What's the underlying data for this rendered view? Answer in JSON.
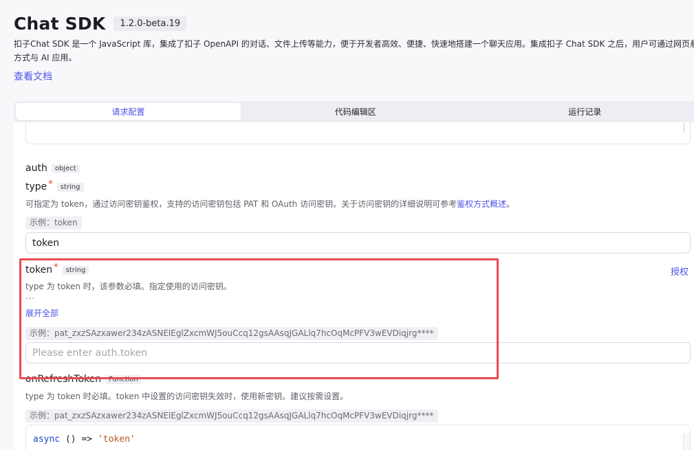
{
  "header": {
    "title": "Chat SDK",
    "version": "1.2.0-beta.19",
    "description_line1": "扣子Chat SDK 是一个 JavaScript 库，集成了扣子 OpenAPI 的对话、文件上传等能力，便于开发者高效、便捷、快速地搭建一个聊天应用。集成扣子 Chat SDK 之后，用户可通过网页悬浮",
    "description_line2": "方式与 AI 应用。",
    "doc_link": "查看文档"
  },
  "tabs": [
    {
      "label": "请求配置",
      "active": true
    },
    {
      "label": "代码编辑区",
      "active": false
    },
    {
      "label": "运行记录",
      "active": false
    }
  ],
  "fields": {
    "auth": {
      "name": "auth",
      "type": "object"
    },
    "type": {
      "name": "type",
      "required_mark": "*",
      "type": "string",
      "help_prefix": "可指定为 token，通过访问密钥鉴权，支持的访问密钥包括 PAT 和 OAuth 访问密钥。关于访问密钥的详细说明可参考",
      "help_link": "鉴权方式概述",
      "help_suffix": "。",
      "example": "示例：token",
      "value": "token"
    },
    "token": {
      "name": "token",
      "required_mark": "*",
      "type": "string",
      "help": "type 为 token 时，该参数必填。指定使用的访问密钥。",
      "ellipsis": "...",
      "expand": "展开全部",
      "example": "示例：pat_zxzSAzxawer234zASNElEglZxcmWJ5ouCcq12gsAAsqJGALlq7hcOqMcPFV3wEVDiqjrg****",
      "placeholder": "Please enter auth.token",
      "auth_link": "授权"
    },
    "onRefreshToken": {
      "name": "onRefreshToken",
      "type": "Function",
      "help": "type 为 token 时必填。token 中设置的访问密钥失效时，使用新密钥。建议按需设置。",
      "example": "示例：pat_zxzSAzxawer234zASNElEglZxcmWJ5ouCcq12gsAAsqJGALlq7hcOqMcPFV3wEVDiqjrg****",
      "code_keyword": "async",
      "code_middle": " () => ",
      "code_string": "'token'"
    }
  },
  "colors": {
    "accent": "#4d53e8",
    "required": "#e6392e",
    "highlight": "#e84a4f"
  }
}
